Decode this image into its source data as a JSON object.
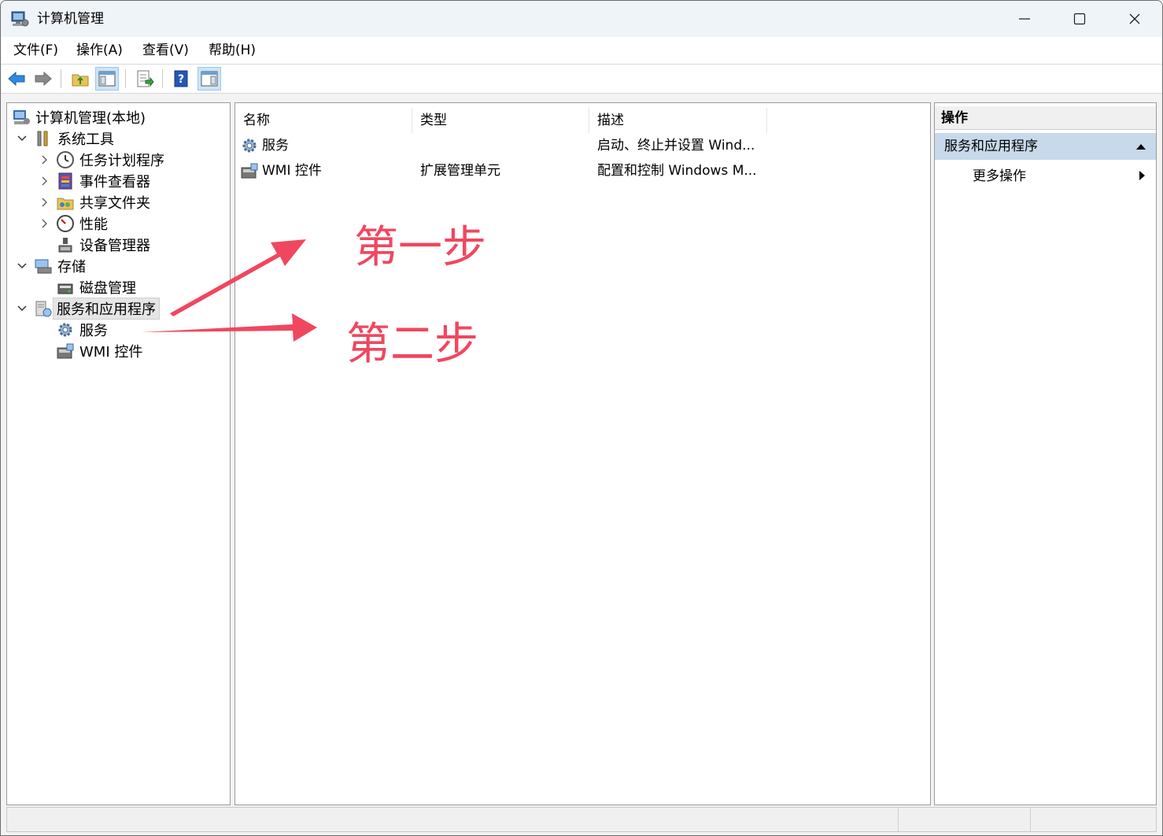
{
  "window": {
    "title": "计算机管理",
    "minimize_label": "Minimize",
    "maximize_label": "Maximize",
    "close_label": "Close"
  },
  "menu": [
    {
      "label": "文件(F)"
    },
    {
      "label": "操作(A)"
    },
    {
      "label": "查看(V)"
    },
    {
      "label": "帮助(H)"
    }
  ],
  "toolbar": {
    "icons": [
      "back-arrow-icon",
      "forward-arrow-icon",
      "up-folder-icon",
      "show-hide-tree-icon",
      "export-list-icon",
      "help-icon",
      "show-hide-action-pane-icon"
    ]
  },
  "tree": {
    "root": "计算机管理(本地)",
    "system_tools": "系统工具",
    "task_scheduler": "任务计划程序",
    "event_viewer": "事件查看器",
    "shared_folders": "共享文件夹",
    "performance": "性能",
    "device_manager": "设备管理器",
    "storage": "存储",
    "disk_management": "磁盘管理",
    "services_apps": "服务和应用程序",
    "services": "服务",
    "wmi_control": "WMI 控件"
  },
  "list": {
    "columns": [
      "名称",
      "类型",
      "描述"
    ],
    "rows": [
      {
        "name": "服务",
        "type": "",
        "description": "启动、终止并设置 Wind..."
      },
      {
        "name": "WMI 控件",
        "type": "扩展管理单元",
        "description": "配置和控制 Windows M..."
      }
    ]
  },
  "actions": {
    "header": "操作",
    "section": "服务和应用程序",
    "more": "更多操作"
  },
  "annotations": {
    "step1": "第一步",
    "step2": "第二步",
    "color": "#f0475f"
  },
  "colors": {
    "selected_section_bg": "#c7d9ea",
    "titlebar_bg": "#eff4f9"
  }
}
